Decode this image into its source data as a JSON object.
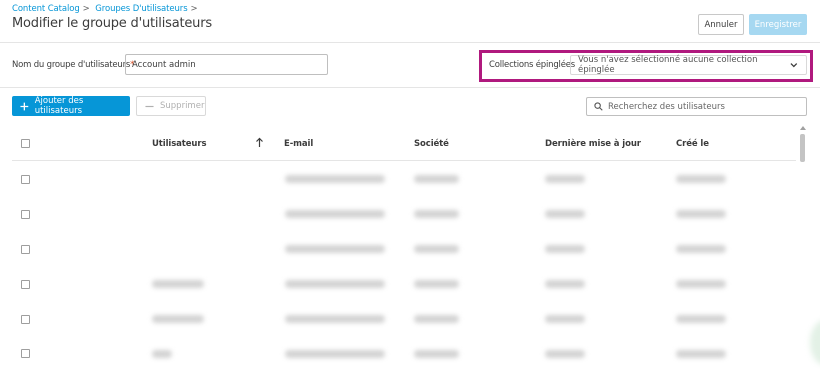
{
  "breadcrumb": [
    {
      "label": "Content Catalog"
    },
    {
      "label": "Groupes D'utilisateurs"
    }
  ],
  "breadcrumb_separator": ">",
  "page_title": "Modifier le groupe d'utilisateurs",
  "header_actions": {
    "cancel_label": "Annuler",
    "save_label": "Enregistrer"
  },
  "form": {
    "group_name_label": "Nom du groupe d'utilisateurs",
    "required_marker": "*",
    "group_name_value": "Account admin",
    "pinned_label": "Collections épinglées",
    "pinned_value": "Vous n'avez sélectionné aucune collection épinglée"
  },
  "toolbar": {
    "add_label": "Ajouter des utilisateurs",
    "delete_label": "Supprimer",
    "search_placeholder": "Recherchez des utilisateurs"
  },
  "table": {
    "columns": [
      "Utilisateurs",
      "E-mail",
      "Société",
      "Dernière mise à jour",
      "Créé le"
    ],
    "sort": {
      "column": "Utilisateurs",
      "direction": "ascending"
    },
    "rows_visible": 6
  },
  "colors": {
    "accent": "#0696d7",
    "save_disabled": "#a6d8f1",
    "highlight_frame": "#b0197e",
    "required": "#d74e26"
  },
  "icons": [
    "plus-icon",
    "minus-icon",
    "search-icon",
    "chevron-down-icon",
    "sort-up-arrow-icon"
  ]
}
